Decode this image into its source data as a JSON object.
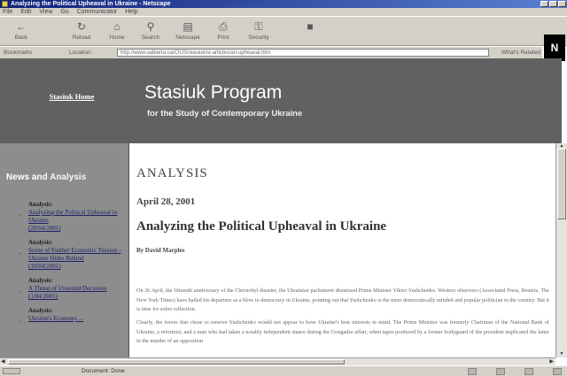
{
  "window": {
    "title": "Analyzing the Political Upheaval in Ukraine - Netscape"
  },
  "menu": [
    "File",
    "Edit",
    "View",
    "Go",
    "Communicator",
    "Help"
  ],
  "toolbar": {
    "back": "Back",
    "reload": "Reload",
    "home": "Home",
    "search": "Search",
    "netscape": "Netscape",
    "print": "Print",
    "security": "Security"
  },
  "locationbar": {
    "bookmarks": "Bookmarks",
    "location_label": "Location:",
    "url": "http://www.ualberta.ca/CIUS/stasiuk/st-articles/an-upheaval.htm",
    "related": "What's Related"
  },
  "header": {
    "home_link": "Stasiuk Home",
    "title": "Stasiuk Program",
    "subtitle": "for the Study of Contemporary Ukraine"
  },
  "sidebar": {
    "heading_a": "News and ",
    "heading_b": "Analysis",
    "items": [
      {
        "label": "Analysis:",
        "text": "Analyzing the Political Upheaval in Ukraine",
        "date": "(28/04/2001)"
      },
      {
        "label": "Analysis:",
        "text": "Scene of Further Economic Tension - Ukraine Hides Behind",
        "date": "(10/04/2001)"
      },
      {
        "label": "Analysis:",
        "text": "A Threat of Unsound Decisions",
        "date": "(1/04/2001)"
      },
      {
        "label": "Analysis:",
        "text": "Ukraine's Economy ...",
        "date": ""
      }
    ]
  },
  "article": {
    "section": "ANALYSIS",
    "date": "April 28, 2001",
    "headline": "Analyzing the Political Upheaval in Ukraine",
    "byline": "By David Marples",
    "p1": "On 26 April, the fifteenth anniversary of the Chernobyl disaster, the Ukrainian parliament dismissed Prime Minister Viktor Yushchenko. Western observers (Associated Press, Reuters, The New York Times) have hailed his departure as a blow to democracy in Ukraine, pointing out that Yushchenko is the most democratically minded and popular politician in the country. But it is time for sober reflection.",
    "p2": "Clearly, the forces that chose to remove Yushchenko would not appear to have Ukraine's best interests in mind. The Prime Minister was formerly Chairman of the National Bank of Ukraine, a reformist, and a man who had taken a notably independent stance during the Gongadze affair, when tapes produced by a former bodyguard of the president implicated the latter in the murder of an opposition"
  },
  "status": {
    "text": "Document: Done"
  }
}
